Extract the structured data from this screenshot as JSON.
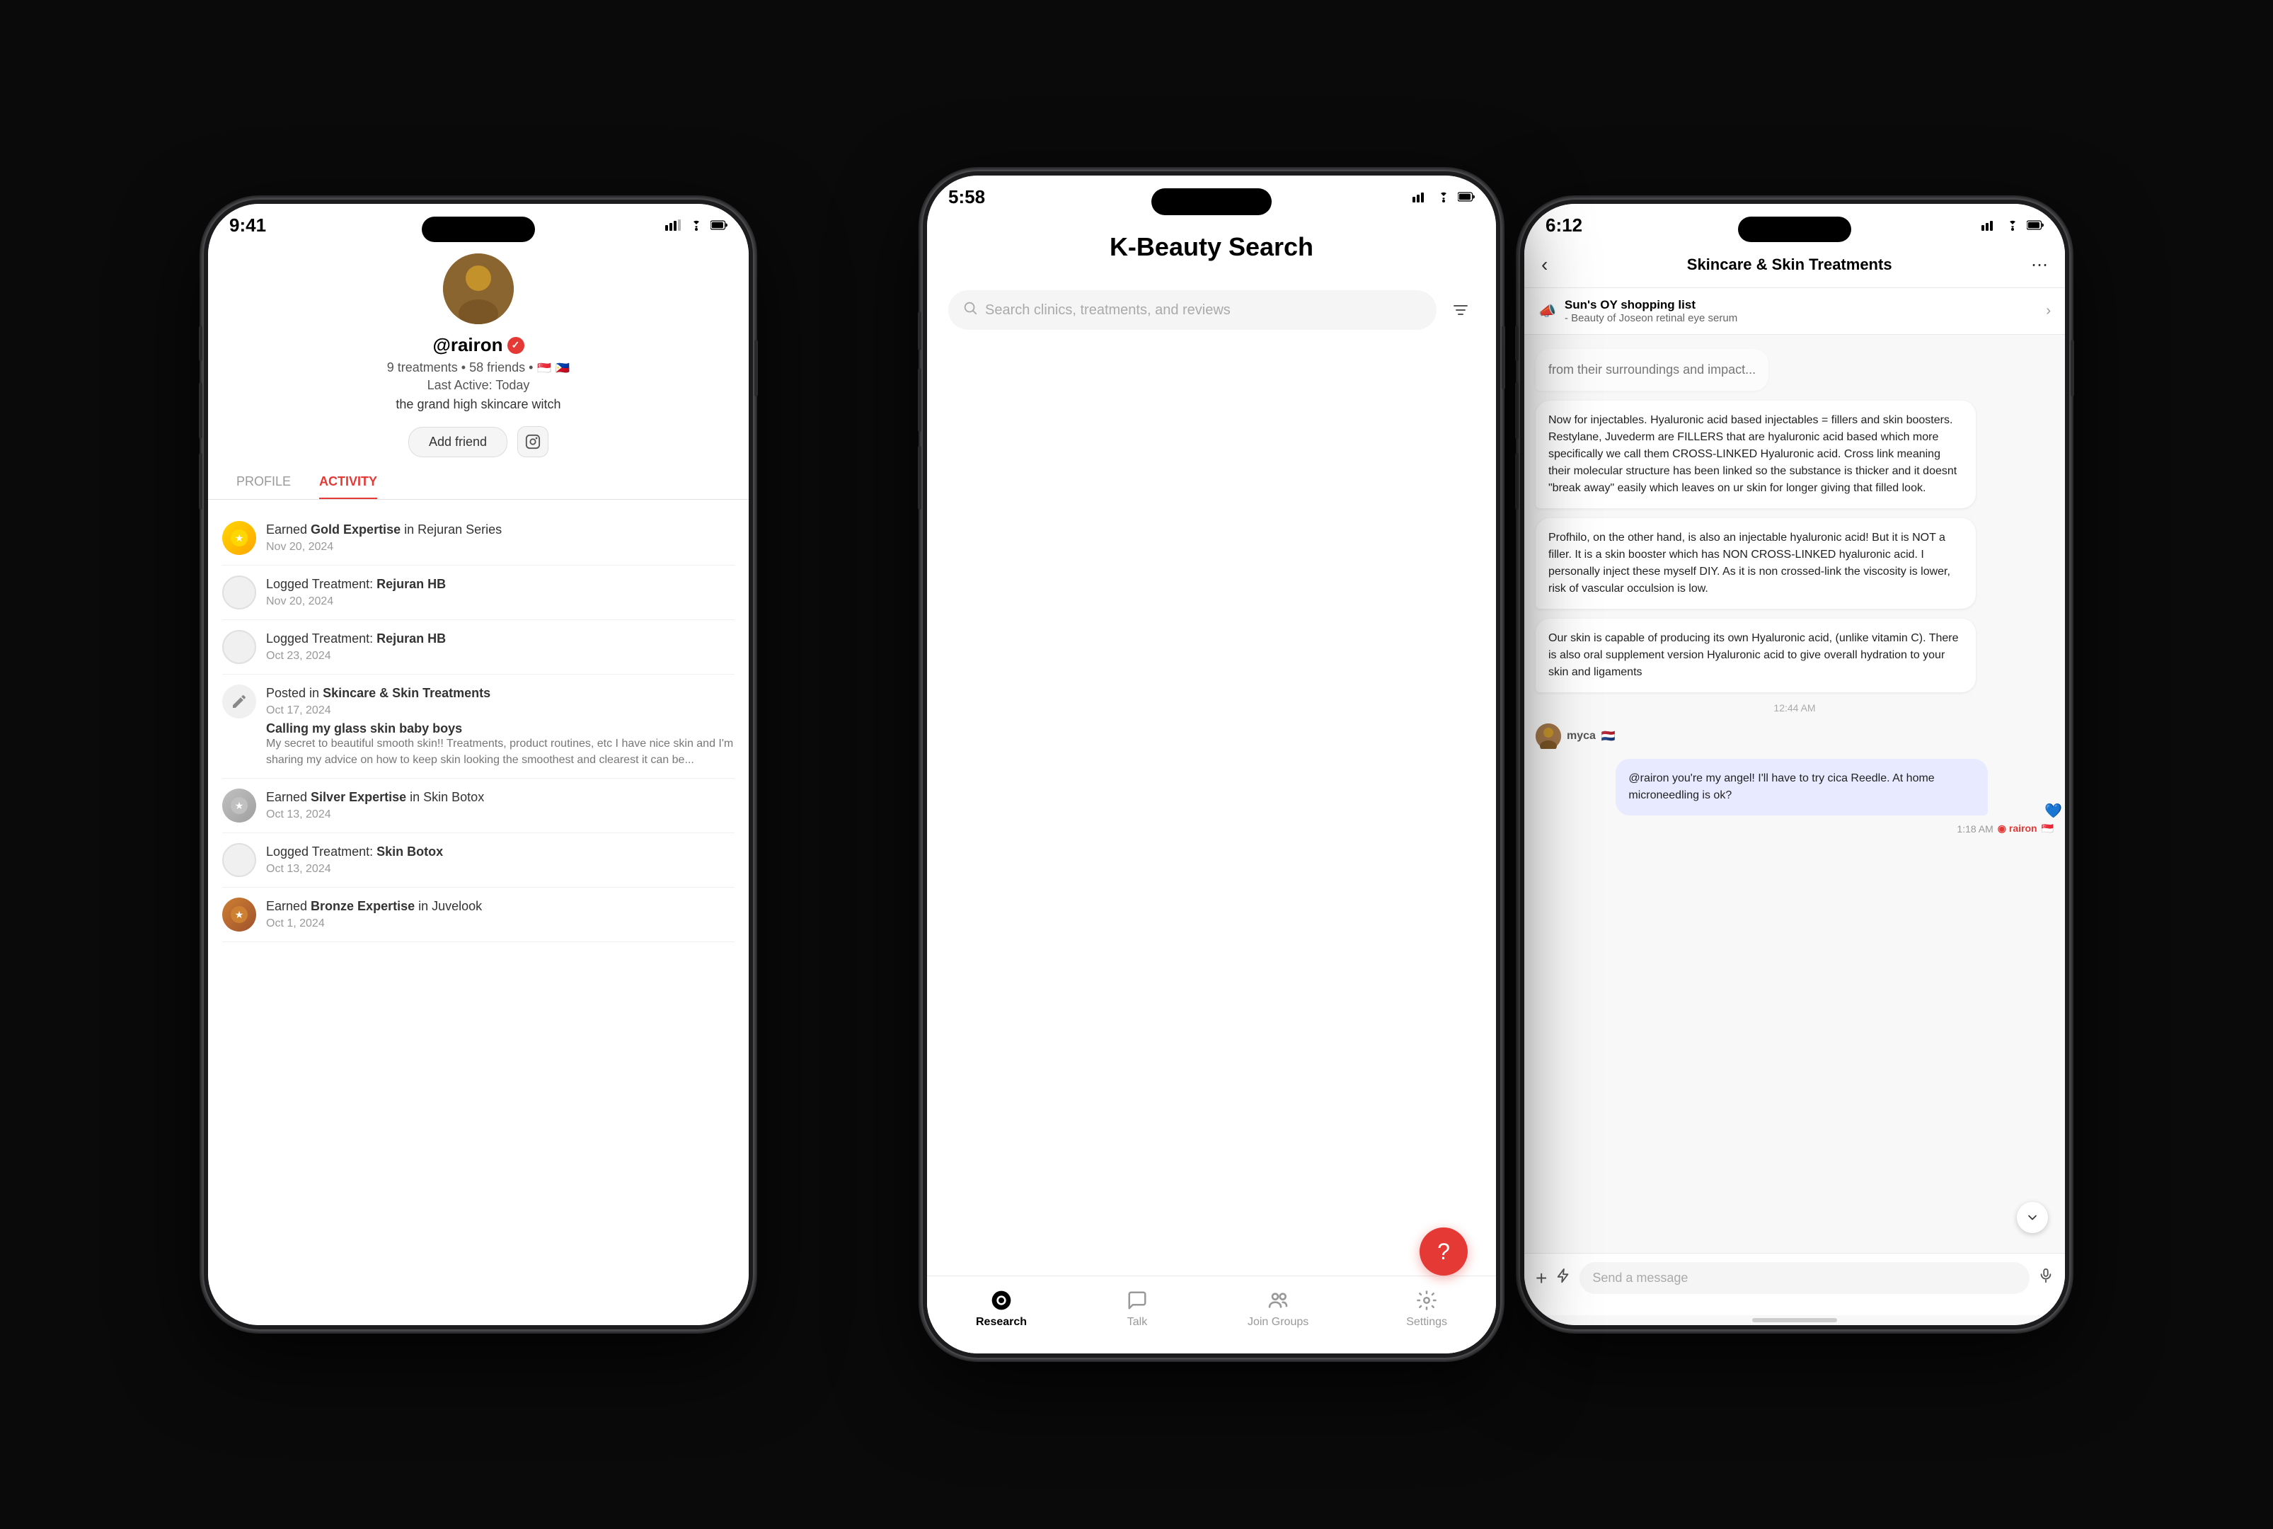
{
  "left_phone": {
    "status_time": "9:41",
    "username": "@rairon",
    "stats": "9 treatments • 58 friends •",
    "last_active": "Last Active: Today",
    "bio": "the grand high skincare witch",
    "add_friend_label": "Add friend",
    "tab_profile": "PROFILE",
    "tab_activity": "ACTIVITY",
    "activities": [
      {
        "type": "gold",
        "text_prefix": "Earned ",
        "text_bold": "Gold Expertise",
        "text_suffix": " in Rejuran Series",
        "date": "Nov 20, 2024"
      },
      {
        "type": "circle",
        "text_prefix": "Logged Treatment: ",
        "text_bold": "Rejuran HB",
        "text_suffix": "",
        "date": "Nov 20, 2024"
      },
      {
        "type": "circle",
        "text_prefix": "Logged Treatment: ",
        "text_bold": "Rejuran HB",
        "text_suffix": "",
        "date": "Oct 23, 2024"
      },
      {
        "type": "pencil",
        "text_prefix": "Posted in ",
        "text_bold": "Skincare & Skin Treatments",
        "text_suffix": "",
        "date": "Oct 17, 2024",
        "post_title": "Calling my glass skin baby boys",
        "post_body": "My secret to beautiful smooth skin!! Treatments, product routines, etc I have nice skin and I'm sharing my advice on how to keep skin looking the smoothest and clearest it can be..."
      },
      {
        "type": "silver",
        "text_prefix": "Earned ",
        "text_bold": "Silver Expertise",
        "text_suffix": " in Skin Botox",
        "date": "Oct 13, 2024"
      },
      {
        "type": "circle",
        "text_prefix": "Logged Treatment: ",
        "text_bold": "Skin Botox",
        "text_suffix": "",
        "date": "Oct 13, 2024"
      },
      {
        "type": "bronze",
        "text_prefix": "Earned ",
        "text_bold": "Bronze Expertise",
        "text_suffix": " in Juvelook",
        "date": "Oct 1, 2024"
      }
    ]
  },
  "center_phone": {
    "status_time": "5:58",
    "title": "K-Beauty Search",
    "search_placeholder": "Search clinics, treatments, and reviews",
    "fab_icon": "?",
    "nav_items": [
      {
        "label": "Research",
        "active": true,
        "icon": "heart"
      },
      {
        "label": "Talk",
        "active": false,
        "icon": "bubble"
      },
      {
        "label": "Join Groups",
        "active": false,
        "icon": "people"
      },
      {
        "label": "Settings",
        "active": false,
        "icon": "gear"
      }
    ]
  },
  "right_phone": {
    "status_time": "6:12",
    "header_title": "Skincare & Skin Treatments",
    "pinned_title": "Sun's OY shopping list",
    "pinned_subtitle": "- Beauty of Joseon retinal eye serum",
    "messages": [
      {
        "type": "fade",
        "text": "from their surroundings and impact..."
      },
      {
        "type": "left",
        "text": "Now for injectables. Hyaluronic acid based injectables = fillers and skin boosters. Restylane, Juvederm are FILLERS that are hyaluronic acid based which more specifically we call them CROSS-LINKED Hyaluronic acid. Cross link meaning their molecular structure has been linked so the substance is thicker and it doesnt \"break away\" easily which leaves on ur skin for longer giving that filled look."
      },
      {
        "type": "left",
        "text": "Profhilo, on the other hand, is also an injectable hyaluronic acid! But it is NOT a filler. It is a skin booster which has NON CROSS-LINKED hyaluronic acid. I personally inject these myself DIY. As it is non crossed-link the viscosity is lower, risk of vascular occulsion is low."
      },
      {
        "type": "left",
        "text": "Our skin is capable of producing its own Hyaluronic acid, (unlike vitamin C). There is also oral supplement version Hyaluronic acid to give overall hydration to your skin and ligaments"
      },
      {
        "type": "timestamp",
        "text": "12:44 AM"
      },
      {
        "type": "user_label",
        "username": "myca",
        "flag": "🇳🇱"
      },
      {
        "type": "right",
        "text": "@rairon you're my angel! I'll have to try cica Reedle. At home microneedling is ok?",
        "has_heart": true,
        "timestamp": "1:18 AM",
        "user_tag": "rairon 🇸🇬"
      }
    ],
    "input_placeholder": "Send a message"
  }
}
